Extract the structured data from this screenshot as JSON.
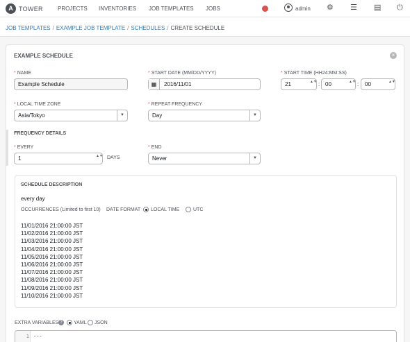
{
  "app": {
    "logo_letter": "A",
    "brand": "TOWER"
  },
  "nav": {
    "items": [
      {
        "label": "PROJECTS"
      },
      {
        "label": "INVENTORIES"
      },
      {
        "label": "JOB TEMPLATES"
      },
      {
        "label": "JOBS"
      }
    ],
    "user": "admin",
    "status_color": "#d9534f"
  },
  "breadcrumb": {
    "items": [
      {
        "label": "JOB TEMPLATES"
      },
      {
        "label": "EXAMPLE JOB TEMPLATE"
      },
      {
        "label": "SCHEDULES"
      }
    ],
    "current": "CREATE SCHEDULE",
    "separator": "/"
  },
  "form": {
    "title": "EXAMPLE SCHEDULE",
    "close_glyph": "×",
    "name": {
      "label": "NAME",
      "value": "Example Schedule"
    },
    "start_date": {
      "label": "START DATE (MM/DD/YYYY)",
      "value": "2016/11/01"
    },
    "start_time": {
      "label": "START TIME (HH24:MM:SS)",
      "hour": "21",
      "minute": "00",
      "second": "00"
    },
    "timezone": {
      "label": "LOCAL TIME ZONE",
      "value": "Asia/Tokyo"
    },
    "repeat": {
      "label": "REPEAT FREQUENCY",
      "value": "Day"
    },
    "frequency_title": "FREQUENCY DETAILS",
    "every": {
      "label": "EVERY",
      "value": "1",
      "unit": "DAYS"
    },
    "end": {
      "label": "END",
      "value": "Never"
    }
  },
  "description": {
    "title": "SCHEDULE DESCRIPTION",
    "text": "every day",
    "occurrences_label": "OCCURRENCES (Limited to first 10)",
    "date_format_label": "DATE FORMAT",
    "local_time_label": "LOCAL TIME",
    "utc_label": "UTC",
    "occurrences": [
      "11/01/2016 21:00:00 JST",
      "11/02/2016 21:00:00 JST",
      "11/03/2016 21:00:00 JST",
      "11/04/2016 21:00:00 JST",
      "11/05/2016 21:00:00 JST",
      "11/06/2016 21:00:00 JST",
      "11/07/2016 21:00:00 JST",
      "11/08/2016 21:00:00 JST",
      "11/09/2016 21:00:00 JST",
      "11/10/2016 21:00:00 JST"
    ]
  },
  "extra_vars": {
    "label": "EXTRA VARIABLES",
    "help_glyph": "?",
    "yaml_label": "YAML",
    "json_label": "JSON",
    "line_number": "1",
    "code": "---"
  },
  "icons": {
    "required_mark": "*",
    "spin_glyph": "▲▼",
    "caret_glyph": "▼",
    "calendar_glyph": "▦",
    "settings_glyph": "⚙",
    "list_glyph": "☰",
    "book_glyph": "▤",
    "power_glyph": "⏻"
  }
}
